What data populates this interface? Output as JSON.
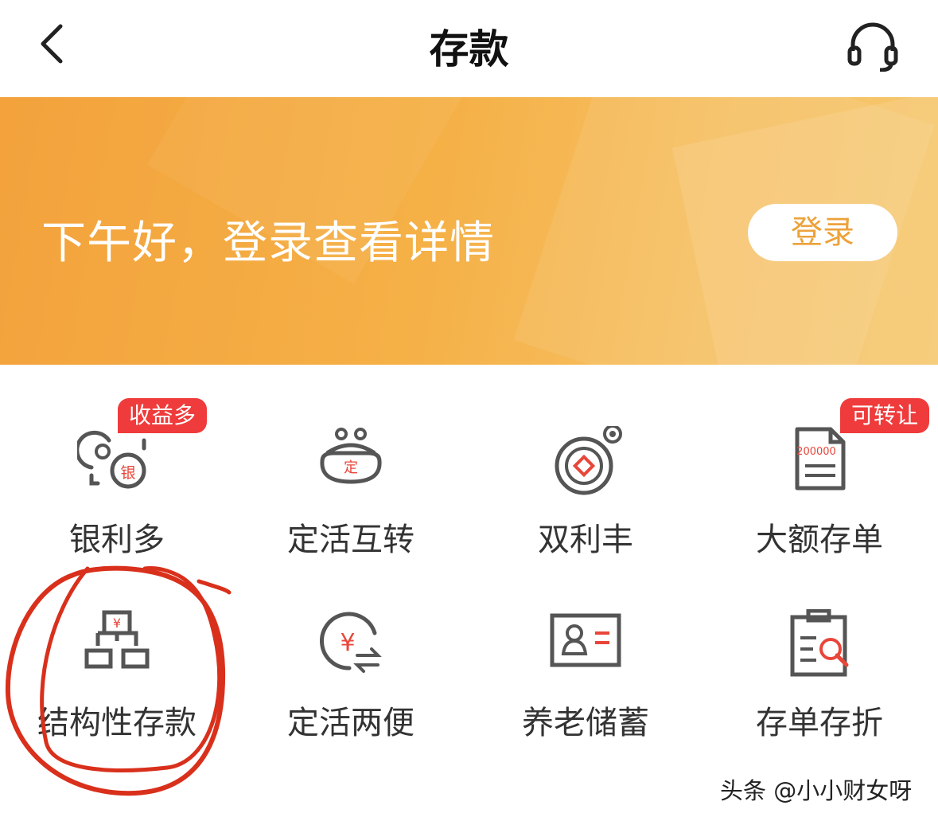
{
  "header": {
    "title": "存款"
  },
  "banner": {
    "greeting": "下午好，登录查看详情",
    "login_label": "登录"
  },
  "grid": [
    {
      "label": "银利多",
      "icon": "coins-icon",
      "badge": "收益多"
    },
    {
      "label": "定活互转",
      "icon": "purse-icon",
      "icon_text": "定"
    },
    {
      "label": "双利丰",
      "icon": "coin-icon"
    },
    {
      "label": "大额存单",
      "icon": "certificate-icon",
      "icon_text": "200000",
      "badge": "可转让"
    },
    {
      "label": "结构性存款",
      "icon": "structure-icon"
    },
    {
      "label": "定活两便",
      "icon": "yuan-exchange-icon"
    },
    {
      "label": "养老储蓄",
      "icon": "id-card-icon"
    },
    {
      "label": "存单存折",
      "icon": "clipboard-search-icon"
    }
  ],
  "watermark": "头条 @小小财女呀",
  "colors": {
    "accent": "#eda23a",
    "badge": "#ef3b3b",
    "icon_red": "#e8463a",
    "icon_gray": "#555555",
    "annotation": "#d9301c"
  }
}
